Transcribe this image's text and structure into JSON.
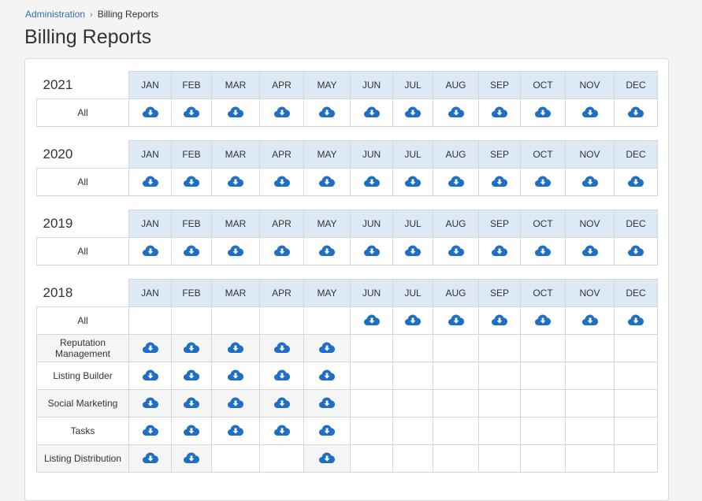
{
  "breadcrumb": {
    "parent": "Administration",
    "current": "Billing Reports"
  },
  "page_title": "Billing Reports",
  "months": [
    "JAN",
    "FEB",
    "MAR",
    "APR",
    "MAY",
    "JUN",
    "JUL",
    "AUG",
    "SEP",
    "OCT",
    "NOV",
    "DEC"
  ],
  "icon": {
    "name": "cloud-download-icon",
    "color": "#1f6fc5"
  },
  "years": [
    {
      "year": "2021",
      "rows": [
        {
          "label": "All",
          "available": [
            1,
            1,
            1,
            1,
            1,
            1,
            1,
            1,
            1,
            1,
            1,
            1
          ]
        }
      ]
    },
    {
      "year": "2020",
      "rows": [
        {
          "label": "All",
          "available": [
            1,
            1,
            1,
            1,
            1,
            1,
            1,
            1,
            1,
            1,
            1,
            1
          ]
        }
      ]
    },
    {
      "year": "2019",
      "rows": [
        {
          "label": "All",
          "available": [
            1,
            1,
            1,
            1,
            1,
            1,
            1,
            1,
            1,
            1,
            1,
            1
          ]
        }
      ]
    },
    {
      "year": "2018",
      "rows": [
        {
          "label": "All",
          "available": [
            0,
            0,
            0,
            0,
            0,
            1,
            1,
            1,
            1,
            1,
            1,
            1
          ]
        },
        {
          "label": "Reputation Management",
          "available": [
            1,
            1,
            1,
            1,
            1,
            0,
            0,
            0,
            0,
            0,
            0,
            0
          ]
        },
        {
          "label": "Listing Builder",
          "available": [
            1,
            1,
            1,
            1,
            1,
            0,
            0,
            0,
            0,
            0,
            0,
            0
          ]
        },
        {
          "label": "Social Marketing",
          "available": [
            1,
            1,
            1,
            1,
            1,
            0,
            0,
            0,
            0,
            0,
            0,
            0
          ]
        },
        {
          "label": "Tasks",
          "available": [
            1,
            1,
            1,
            1,
            1,
            0,
            0,
            0,
            0,
            0,
            0,
            0
          ]
        },
        {
          "label": "Listing Distribution",
          "available": [
            1,
            1,
            0,
            0,
            1,
            0,
            0,
            0,
            0,
            0,
            0,
            0
          ]
        }
      ]
    }
  ]
}
